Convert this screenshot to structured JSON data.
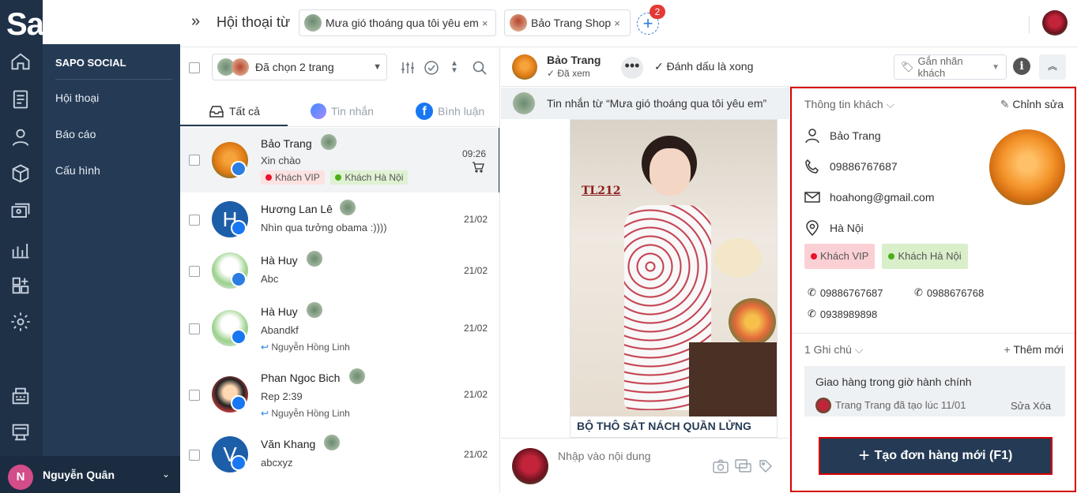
{
  "app": {
    "logo": "Sapo"
  },
  "menu": {
    "title": "SAPO SOCIAL",
    "items": [
      {
        "label": "Hội thoại"
      },
      {
        "label": "Báo cáo"
      },
      {
        "label": "Cấu hình"
      }
    ]
  },
  "user": {
    "initial": "N",
    "name": "Nguyễn Quân"
  },
  "header": {
    "title": "Hội thoại từ",
    "pages": [
      {
        "label": "Mưa gió thoáng qua tôi yêu em",
        "close": "×"
      },
      {
        "label": "Bảo Trang Shop",
        "close": "×"
      }
    ],
    "add_badge": "2"
  },
  "list": {
    "selected_pages_label": "Đã chọn 2 trang",
    "tabs": [
      {
        "label": "Tất cả",
        "active": true
      },
      {
        "label": "Tin nhắn",
        "active": false
      },
      {
        "label": "Bình luận",
        "active": false
      }
    ],
    "conversations": [
      {
        "name": "Bảo Trang",
        "message": "Xin chào",
        "time": "09:26",
        "tags": [
          {
            "label": "Khách VIP",
            "color": "#e8132b"
          },
          {
            "label": "Khách Hà Nội",
            "color": "#4caf1a"
          }
        ],
        "reply": "",
        "source": "messenger",
        "avatar": "flower"
      },
      {
        "name": "Hương Lan Lê",
        "message": "Nhìn qua tưởng obama :))))",
        "time": "21/02",
        "tags": [],
        "reply": "",
        "source": "facebook",
        "avatar": "letter-H"
      },
      {
        "name": "Hà Huy",
        "message": "Abc",
        "time": "21/02",
        "tags": [],
        "reply": "",
        "source": "messenger",
        "avatar": "cartoon"
      },
      {
        "name": "Hà Huy",
        "message": "Abandkf",
        "time": "21/02",
        "tags": [],
        "reply": "Nguyễn Hồng Linh",
        "source": "facebook",
        "avatar": "cartoon"
      },
      {
        "name": "Phan Ngoc Bich",
        "message": "Rep 2:39",
        "time": "21/02",
        "tags": [],
        "reply": "Nguyễn Hồng Linh",
        "source": "facebook",
        "avatar": "girl"
      },
      {
        "name": "Văn Khang",
        "message": "abcxyz",
        "time": "21/02",
        "tags": [],
        "reply": "",
        "source": "facebook",
        "avatar": "letter-V"
      }
    ]
  },
  "chat": {
    "name": "Bảo Trang",
    "status": "Đã xem",
    "mark_done": "Đánh dấu là xong",
    "tag_placeholder": "Gắn nhãn khách",
    "source_prefix": "Tin nhắn từ",
    "source_page": "“Mưa gió thoáng qua tôi yêu em”",
    "product_code": "TL212",
    "product_caption": "BỘ THÔ SÁT NÁCH QUẦN LỬNG",
    "input_placeholder": "Nhập vào nội dung"
  },
  "customer": {
    "section_label": "Thông tin khách",
    "edit_label": "Chỉnh sửa",
    "name": "Bảo Trang",
    "phone": "09886767687",
    "email": "hoahong@gmail.com",
    "location": "Hà Nội",
    "tags": [
      {
        "label": "Khách VIP",
        "color": "#e8132b"
      },
      {
        "label": "Khách Hà Nội",
        "color": "#4caf1a"
      }
    ],
    "phones": [
      "09886767687",
      "0988676768",
      "0938989898"
    ],
    "notes_label": "1 Ghi chú",
    "add_note_label": "Thêm mới",
    "note": {
      "text": "Giao hàng trong giờ hành chính",
      "meta": "Trang Trang đã tạo lúc 11/01",
      "edit": "Sửa",
      "delete": "Xóa"
    },
    "create_order_label": "Tạo đơn hàng mới (F1)"
  },
  "colors": {
    "sidebar": "#1f3147",
    "menu": "#253b55",
    "accent": "#2a7de1",
    "highlight": "#d60000"
  }
}
